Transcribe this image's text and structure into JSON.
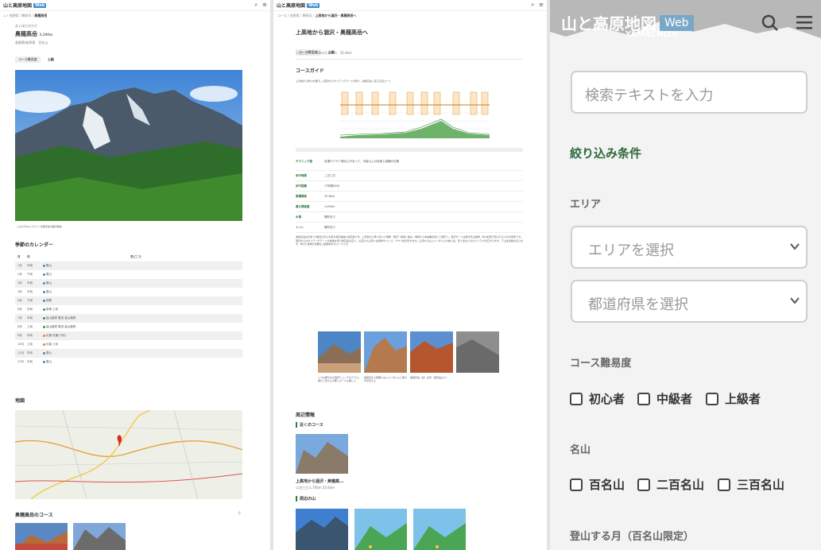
{
  "logo": {
    "text": "山と高原地図",
    "web": "Web",
    "sub": "YAMACHIZU"
  },
  "left": {
    "breadcrumb": [
      "⌂",
      "長野県",
      "穂高岳",
      "奥穂高岳"
    ],
    "kana": "おくほたかだけ",
    "title": "奥穂高岳",
    "elevation": "3,190m",
    "meta1": "長野県/岐阜県",
    "meta2": "百名山",
    "tags": [
      "コース難易度",
      "上級"
    ],
    "photo_caption": "このさきホルプス？1 北穂高岳方面の眺め",
    "calendar_title": "季節のカレンダー",
    "calendar_header": [
      "月",
      "旬",
      "見どころ"
    ],
    "calendar_rows": [
      {
        "m": "1月",
        "d": "中旬",
        "t": "雪山"
      },
      {
        "m": "2月",
        "d": "下旬",
        "t": "雪山"
      },
      {
        "m": "3月",
        "d": "中旬",
        "t": "雪山"
      },
      {
        "m": "4月",
        "d": "中旬",
        "t": "雪山"
      },
      {
        "m": "5月",
        "d": "下旬",
        "t": "残雪"
      },
      {
        "m": "6月",
        "d": "中旬",
        "t": "新緑 上旬"
      },
      {
        "m": "7月",
        "d": "中旬",
        "t": "高山植物 雪渓 高山植物"
      },
      {
        "m": "8月",
        "d": "上旬",
        "t": "高山植物 雪渓 高山植物"
      },
      {
        "m": "9月",
        "d": "中旬",
        "t": "紅葉 紅葉(下旬)"
      },
      {
        "m": "10月",
        "d": "上旬",
        "t": "紅葉 上旬"
      },
      {
        "m": "11月",
        "d": "中旬",
        "t": "雪山"
      },
      {
        "m": "12月",
        "d": "中旬",
        "t": "雪山"
      }
    ],
    "map_title": "地図",
    "courses_title": "奥穂高岳のコース",
    "courses_count": "0"
  },
  "mid": {
    "breadcrumb": [
      "コース",
      "長野県",
      "穂高岳",
      "上高地から涸沢・奥穂高岳へ"
    ],
    "title": "上高地から涸沢・奥穂高岳へ",
    "tags": [
      "コース難易度",
      "上級"
    ],
    "meta": [
      "二泊三日",
      "1,760m/3,190m",
      "35.6km"
    ],
    "guide_title": "コースガイド",
    "guide_sub": "上高地から梓川を遡行して涸沢からザイテングラートを登り、奥穂高岳へ至る王道コース",
    "info": [
      {
        "k": "テクニック度",
        "v": "岩場やクサリ場などがあって、中級以上の技術と経験が必要"
      },
      {
        "k": "歩行時間",
        "v": "二泊三日"
      },
      {
        "k": "歩行距離",
        "v": "17時間40分"
      },
      {
        "k": "累積標高",
        "v": "35.6km"
      },
      {
        "k": "最大標高差",
        "v": "1,650m"
      },
      {
        "k": "水場",
        "v": "随所あり"
      },
      {
        "k": "トイレ",
        "v": "随所あり"
      }
    ],
    "body": "奥穂高岳は日本で3番目の高さを誇る穂高連峰の最高峰です。上高地から梓川沿いに明神・徳沢・横尾と進み、横尾から本谷橋を渡って涸沢へ。涸沢カールは夏の高山植物、秋の紅葉で知られる人気の場所です。涸沢からはザイテングラートの岩稜を登り穂高岳山荘へ。山荘から山頂へは岩場やハシゴ、クサリ場が続きます。山頂からはジャンダルムや槍ヶ岳、笠ヶ岳などの大パノラマが広がります。下山は往路を戻ります。体力と技術が必要な上級者向けのコースです。",
    "thumbs": [
      {
        "cap": "いつも賑やかな涸沢ヒュッテのテラス。紫だと見える小屋とロードも美しい"
      },
      {
        "cap": "奥穂高から西側にはジャンダルムと馬の背が見える"
      },
      {
        "cap": "奥穂高岳（右）全景（涸沢岳より）"
      },
      {
        "cap": ""
      }
    ],
    "nearby_title": "周辺情報",
    "nearby_course_title": "近くのコース",
    "nearby_course_name": "上高地から涸沢・奥穂高...",
    "nearby_course_meta": [
      "二泊三日",
      "1,760m",
      "35.6km"
    ],
    "nearby_mtn_title": "周辺の山"
  },
  "right": {
    "search_placeholder": "検索テキストを入力",
    "filter_title": "絞り込み条件",
    "area_label": "エリア",
    "area_select": "エリアを選択",
    "pref_select": "都道府県を選択",
    "difficulty_label": "コース難易度",
    "difficulty": [
      "初心者",
      "中級者",
      "上級者"
    ],
    "famous_label": "名山",
    "famous": [
      "百名山",
      "二百名山",
      "三百名山"
    ],
    "month_label": "登山する月（百名山限定）"
  },
  "colors": {
    "accent_green": "#2f6a3c",
    "web_blue": "#3a90c8"
  }
}
